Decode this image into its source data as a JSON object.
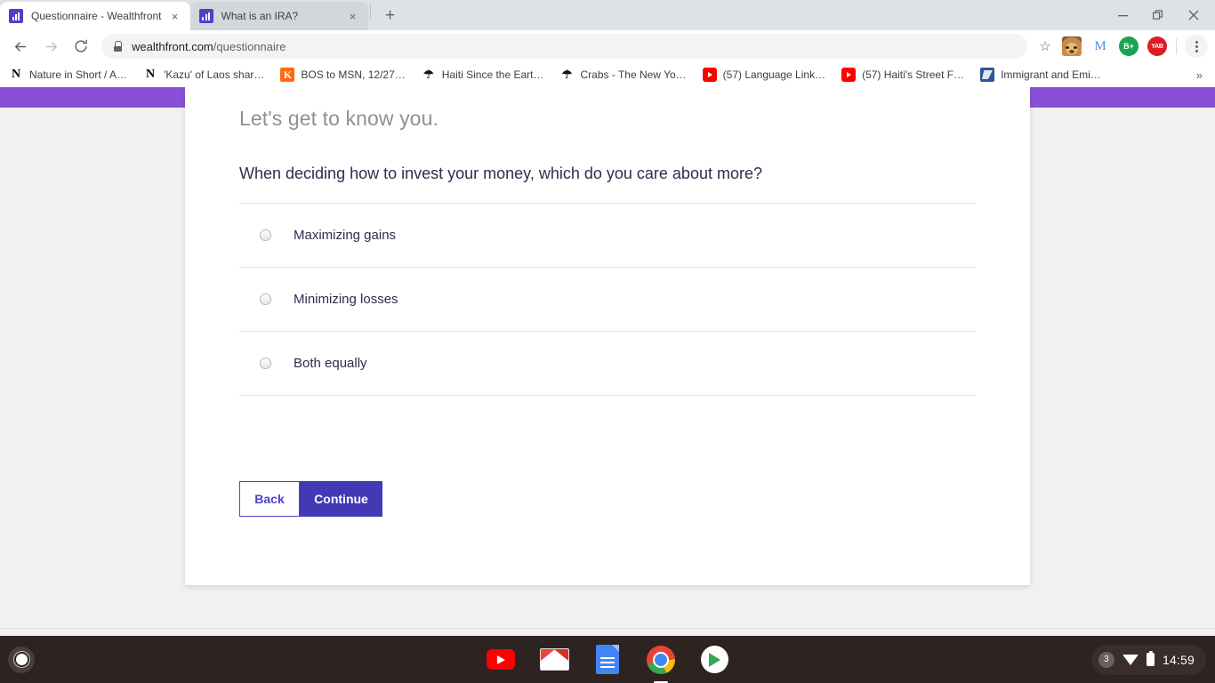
{
  "browser": {
    "tabs": [
      {
        "title": "Questionnaire - Wealthfront",
        "active": true,
        "favicon": "wealthfront-icon"
      },
      {
        "title": "What is an IRA?",
        "active": false,
        "favicon": "wealthfront-icon"
      }
    ],
    "new_tab_label": "+",
    "close_label": "×",
    "window_controls": {
      "minimize": "—",
      "maximize": "❐",
      "close": "✕"
    },
    "nav": {
      "back": "←",
      "forward": "→",
      "reload": "⟳"
    },
    "omnibox": {
      "host": "wealthfront.com",
      "path": "/questionnaire",
      "lock_icon": "lock-icon",
      "star_icon": "☆"
    },
    "extensions": [
      {
        "name": "doge-extension-icon",
        "label": ""
      },
      {
        "name": "m-extension-icon",
        "label": "M"
      },
      {
        "name": "b-plus-extension-icon",
        "label": "B+"
      },
      {
        "name": "yab-extension-icon",
        "label": "YAB"
      }
    ],
    "menu_icon": "kebab-menu-icon",
    "bookmarks": [
      {
        "label": "Nature in Short / A…",
        "icon": "nyt-icon",
        "glyph": "N"
      },
      {
        "label": "'Kazu' of Laos shar…",
        "icon": "nyt-icon",
        "glyph": "N"
      },
      {
        "label": "BOS to MSN, 12/27…",
        "icon": "kayak-icon",
        "glyph": "K"
      },
      {
        "label": "Haiti Since the Eart…",
        "icon": "newyorker-icon",
        "glyph": "☂"
      },
      {
        "label": "Crabs - The New Yo…",
        "icon": "newyorker-icon",
        "glyph": "☂"
      },
      {
        "label": "(57) Language Link…",
        "icon": "youtube-icon",
        "glyph": ""
      },
      {
        "label": "(57) Haiti's Street F…",
        "icon": "youtube-icon",
        "glyph": ""
      },
      {
        "label": "Immigrant and Emi…",
        "icon": "blue-doc-icon",
        "glyph": ""
      }
    ],
    "bookmarks_overflow": "»"
  },
  "page": {
    "greeting": "Let's get to know you.",
    "question": "When deciding how to invest your money, which do you care about more?",
    "options": [
      {
        "label": "Maximizing gains",
        "selected": false
      },
      {
        "label": "Minimizing losses",
        "selected": false
      },
      {
        "label": "Both equally",
        "selected": false
      }
    ],
    "buttons": {
      "back": "Back",
      "continue": "Continue"
    },
    "colors": {
      "hero_purple": "#8b4fd7",
      "brand_indigo": "#4339b5",
      "back_border": "#4c42ca",
      "question_text": "#2b2f4a",
      "greeting_text": "#8d9197",
      "page_background": "#f1f1f1"
    }
  },
  "shelf": {
    "launcher": "launcher-button",
    "apps": [
      {
        "name": "youtube-app-icon",
        "active": false
      },
      {
        "name": "gmail-app-icon",
        "active": false
      },
      {
        "name": "google-docs-app-icon",
        "active": false
      },
      {
        "name": "chrome-app-icon",
        "active": true
      },
      {
        "name": "google-play-app-icon",
        "active": false
      }
    ],
    "tray": {
      "notification_count": "3",
      "wifi_icon": "wifi-icon",
      "battery_icon": "battery-icon",
      "time": "14:59"
    }
  }
}
